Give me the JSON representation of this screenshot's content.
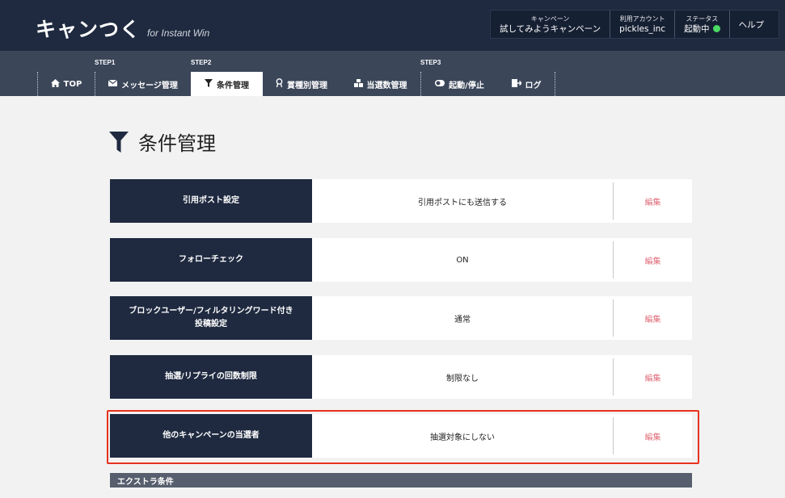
{
  "header": {
    "logo_main": "キャンつく",
    "logo_sub": "for Instant Win",
    "campaign_label": "キャンペーン",
    "campaign_value": "試してみようキャンペーン",
    "account_label": "利用アカウント",
    "account_value": "pickles_inc",
    "status_label": "ステータス",
    "status_value": "起動中",
    "status_color": "#4cd964",
    "help_label": "ヘルプ"
  },
  "nav": {
    "steps": [
      "STEP1",
      "STEP2",
      "STEP3"
    ],
    "tabs": [
      {
        "label": "TOP",
        "icon": "home-icon"
      },
      {
        "label": "メッセージ管理",
        "icon": "envelope-icon"
      },
      {
        "label": "条件管理",
        "icon": "filter-icon"
      },
      {
        "label": "賞種別管理",
        "icon": "award-icon"
      },
      {
        "label": "当選数管理",
        "icon": "boxes-icon"
      },
      {
        "label": "起動/停止",
        "icon": "toggle-icon"
      },
      {
        "label": "ログ",
        "icon": "log-export-icon"
      }
    ],
    "active_tab": "条件管理"
  },
  "page": {
    "title": "条件管理"
  },
  "conditions": [
    {
      "label": "引用ポスト設定",
      "value": "引用ポストにも送信する",
      "edit": "編集"
    },
    {
      "label": "フォローチェック",
      "value": "ON",
      "edit": "編集"
    },
    {
      "label": "ブロックユーザー/フィルタリングワード付き\n投稿設定",
      "value": "通常",
      "edit": "編集"
    },
    {
      "label": "抽選/リプライの回数制限",
      "value": "制限なし",
      "edit": "編集"
    },
    {
      "label": "他のキャンペーンの当選者",
      "value": "抽選対象にしない",
      "edit": "編集"
    }
  ],
  "extra_section": {
    "title": "エクストラ条件"
  },
  "colors": {
    "header_bg": "#1f2a40",
    "nav_bg": "#3b4659",
    "edit_link": "#e06b78",
    "highlight_border": "#e8321e"
  }
}
